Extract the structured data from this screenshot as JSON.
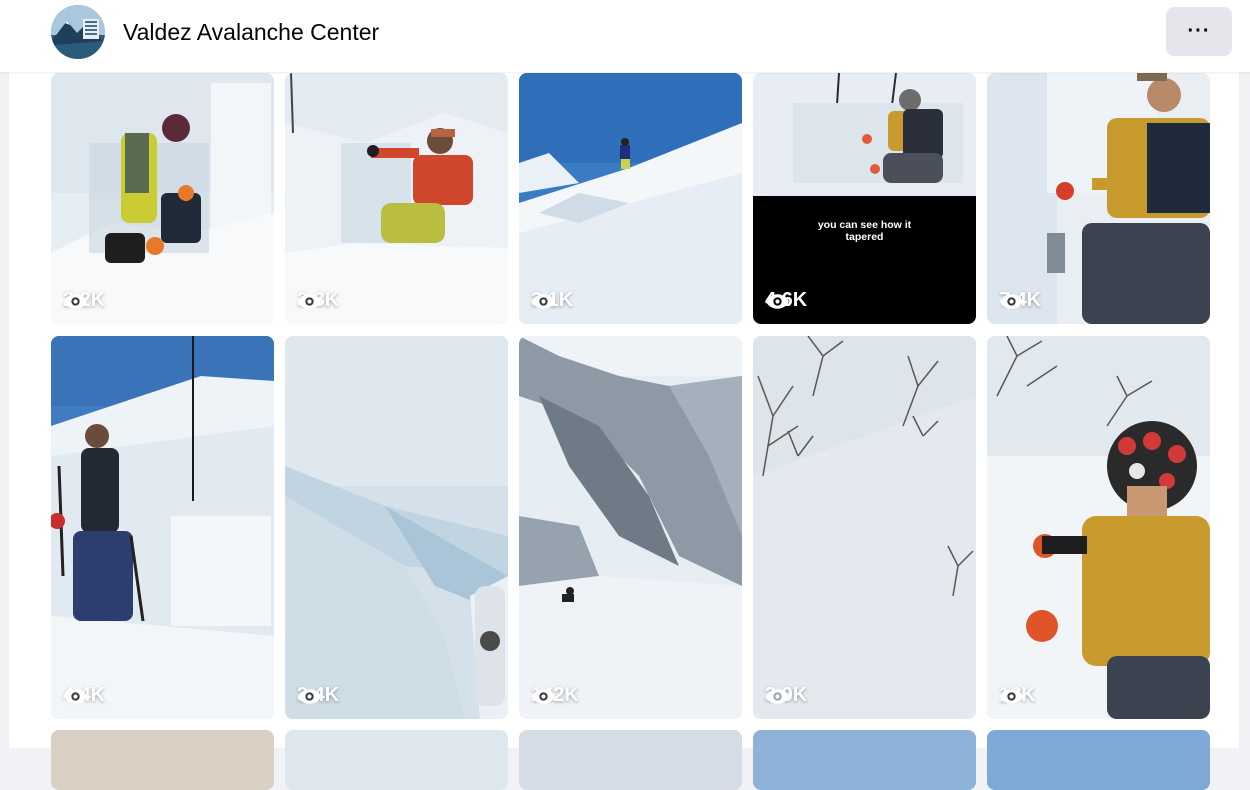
{
  "header": {
    "page_name": "Valdez Avalanche Center",
    "more_label": "···"
  },
  "reels": [
    {
      "views": "2.2K"
    },
    {
      "views": "3.3K"
    },
    {
      "views": "3.1K"
    },
    {
      "views": "4.6K",
      "caption_line1": "you can see how it",
      "caption_line2": "tapered"
    },
    {
      "views": "7.4K"
    },
    {
      "views": "4.4K"
    },
    {
      "views": "3.4K"
    },
    {
      "views": "142K"
    },
    {
      "views": "3.9K"
    },
    {
      "views": "13K"
    }
  ],
  "icons": {
    "views": "eye-icon",
    "more": "ellipsis-icon"
  }
}
